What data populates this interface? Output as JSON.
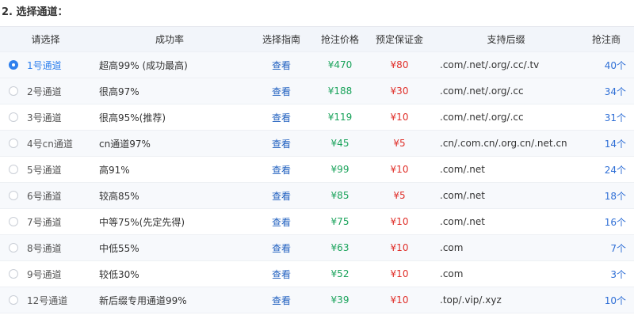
{
  "section_title": "2. 选择通道：",
  "columns": {
    "select": "请选择",
    "rate": "成功率",
    "guide": "选择指南",
    "price": "抢注价格",
    "deposit": "预定保证金",
    "suffix": "支持后缀",
    "registrar": "抢注商"
  },
  "rows": [
    {
      "name": "1号通道",
      "rate": "超高99% (成功最高)",
      "guide": "查看",
      "price": "¥470",
      "deposit": "¥80",
      "suffix": ".com/.net/.org/.cc/.tv",
      "registrar": "40个",
      "selected": true
    },
    {
      "name": "2号通道",
      "rate": "很高97%",
      "guide": "查看",
      "price": "¥188",
      "deposit": "¥30",
      "suffix": ".com/.net/.org/.cc",
      "registrar": "34个",
      "selected": false
    },
    {
      "name": "3号通道",
      "rate": "很高95%(推荐)",
      "guide": "查看",
      "price": "¥119",
      "deposit": "¥10",
      "suffix": ".com/.net/.org/.cc",
      "registrar": "31个",
      "selected": false
    },
    {
      "name": "4号cn通道",
      "rate": "cn通道97%",
      "guide": "查看",
      "price": "¥45",
      "deposit": "¥5",
      "suffix": ".cn/.com.cn/.org.cn/.net.cn",
      "registrar": "14个",
      "selected": false
    },
    {
      "name": "5号通道",
      "rate": "高91%",
      "guide": "查看",
      "price": "¥99",
      "deposit": "¥10",
      "suffix": ".com/.net",
      "registrar": "24个",
      "selected": false
    },
    {
      "name": "6号通道",
      "rate": "较高85%",
      "guide": "查看",
      "price": "¥85",
      "deposit": "¥5",
      "suffix": ".com/.net",
      "registrar": "18个",
      "selected": false
    },
    {
      "name": "7号通道",
      "rate": "中等75%(先定先得)",
      "guide": "查看",
      "price": "¥75",
      "deposit": "¥10",
      "suffix": ".com/.net",
      "registrar": "16个",
      "selected": false
    },
    {
      "name": "8号通道",
      "rate": "中低55%",
      "guide": "查看",
      "price": "¥63",
      "deposit": "¥10",
      "suffix": ".com",
      "registrar": "7个",
      "selected": false
    },
    {
      "name": "9号通道",
      "rate": "较低30%",
      "guide": "查看",
      "price": "¥52",
      "deposit": "¥10",
      "suffix": ".com",
      "registrar": "3个",
      "selected": false
    },
    {
      "name": "12号通道",
      "rate": "新后缀专用通道99%",
      "guide": "查看",
      "price": "¥39",
      "deposit": "¥10",
      "suffix": ".top/.vip/.xyz",
      "registrar": "10个",
      "selected": false
    }
  ],
  "colors": {
    "accent": "#2f80ed",
    "price": "#1aa35b",
    "deposit": "#e0302a",
    "link": "#1f5fbf"
  }
}
